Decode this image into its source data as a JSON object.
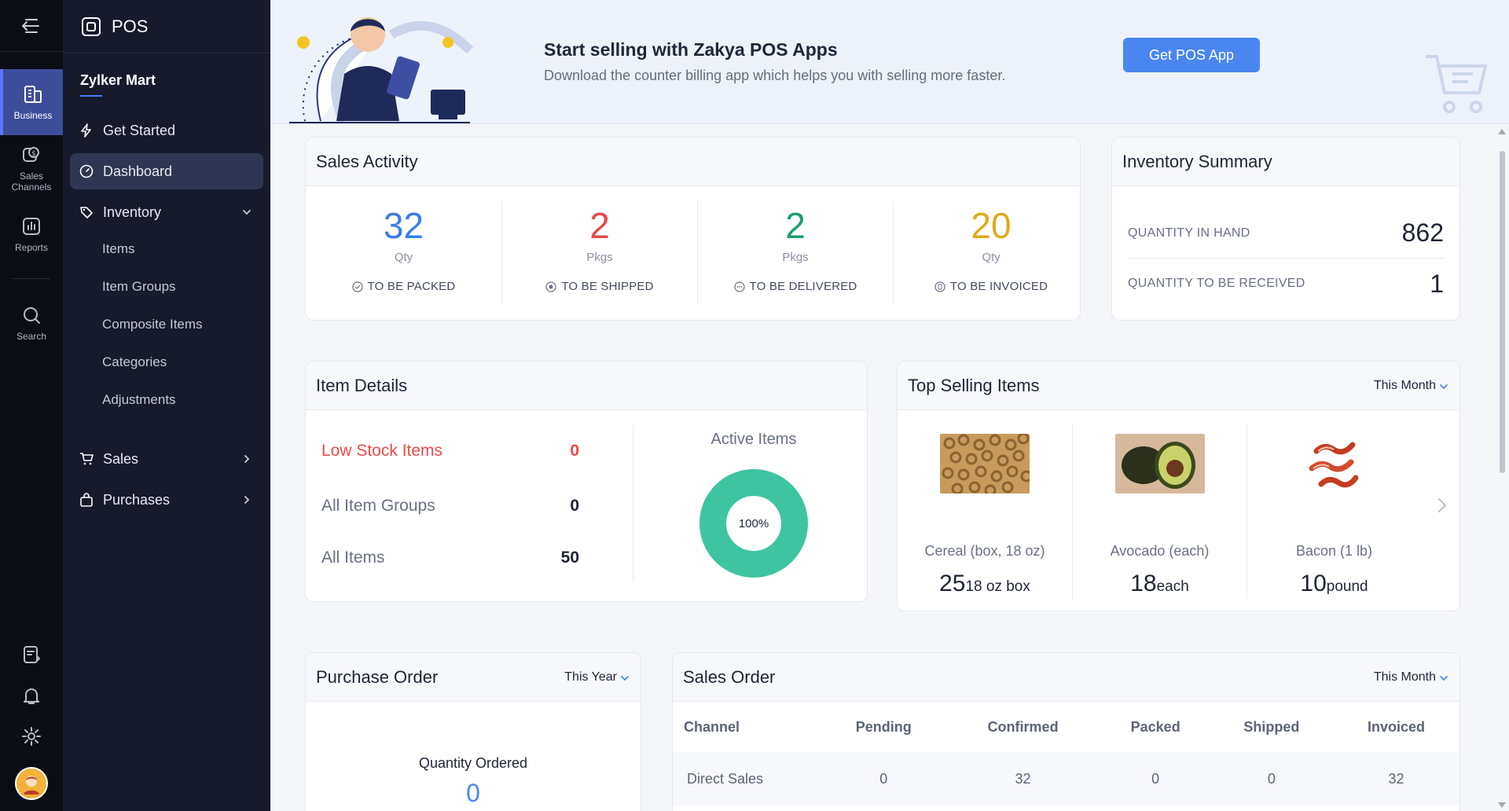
{
  "rail": {
    "items": [
      {
        "label": "Business",
        "icon": "building-icon"
      },
      {
        "label": "Sales Channels",
        "icon": "sales-channels-icon"
      },
      {
        "label": "Reports",
        "icon": "bar-chart-icon"
      },
      {
        "label": "Search",
        "icon": "search-icon"
      }
    ]
  },
  "nav": {
    "app_name": "POS",
    "org_name": "Zylker Mart",
    "get_started": "Get Started",
    "dashboard": "Dashboard",
    "inventory": "Inventory",
    "inventory_items": [
      "Items",
      "Item Groups",
      "Composite Items",
      "Categories",
      "Adjustments"
    ],
    "sales": "Sales",
    "purchases": "Purchases"
  },
  "banner": {
    "title": "Start selling with Zakya POS Apps",
    "subtitle": "Download the counter billing app which helps you with selling more faster.",
    "button": "Get POS App"
  },
  "sales_activity": {
    "title": "Sales Activity",
    "columns": [
      {
        "value": "32",
        "unit": "Qty",
        "label": "TO BE PACKED",
        "color": "#3d7ee6"
      },
      {
        "value": "2",
        "unit": "Pkgs",
        "label": "TO BE SHIPPED",
        "color": "#e8474b"
      },
      {
        "value": "2",
        "unit": "Pkgs",
        "label": "TO BE DELIVERED",
        "color": "#1f9d6a"
      },
      {
        "value": "20",
        "unit": "Qty",
        "label": "TO BE INVOICED",
        "color": "#e2a91c"
      }
    ]
  },
  "inventory_summary": {
    "title": "Inventory Summary",
    "in_hand_label": "QUANTITY IN HAND",
    "in_hand_value": "862",
    "to_receive_label": "QUANTITY TO BE RECEIVED",
    "to_receive_value": "1"
  },
  "item_details": {
    "title": "Item Details",
    "rows": [
      {
        "label": "Low Stock Items",
        "value": "0"
      },
      {
        "label": "All Item Groups",
        "value": "0"
      },
      {
        "label": "All Items",
        "value": "50"
      }
    ],
    "active_title": "Active Items",
    "active_percent_label": "100%",
    "active_fraction": 1.0,
    "donut_color": "#3ec4a1"
  },
  "top_selling": {
    "title": "Top Selling Items",
    "filter": "This Month",
    "items": [
      {
        "name": "Cereal (box, 18 oz)",
        "qty": "25",
        "unit": "18 oz box"
      },
      {
        "name": "Avocado (each)",
        "qty": "18",
        "unit": "each"
      },
      {
        "name": "Bacon (1 lb)",
        "qty": "10",
        "unit": "pound"
      }
    ]
  },
  "purchase_order": {
    "title": "Purchase Order",
    "filter": "This Year",
    "qty_label": "Quantity Ordered",
    "qty_value": "0"
  },
  "sales_order": {
    "title": "Sales Order",
    "filter": "This Month",
    "columns": [
      "Channel",
      "Pending",
      "Confirmed",
      "Packed",
      "Shipped",
      "Invoiced"
    ],
    "rows": [
      [
        "Direct Sales",
        "0",
        "32",
        "0",
        "0",
        "32"
      ]
    ]
  }
}
